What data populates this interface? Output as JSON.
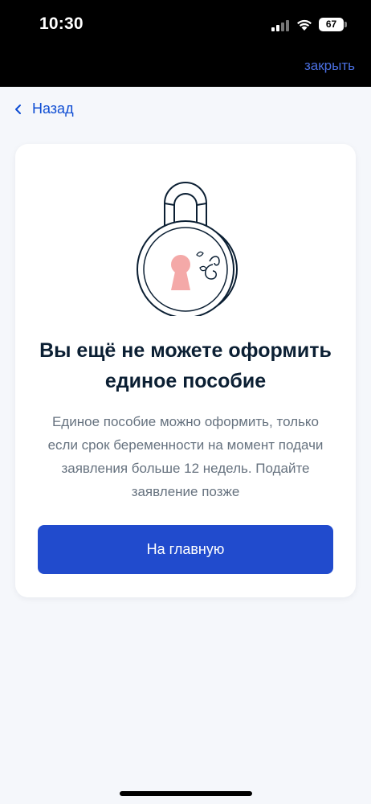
{
  "status_bar": {
    "time": "10:30",
    "battery": "67"
  },
  "header": {
    "close_label": "закрыть"
  },
  "nav": {
    "back_label": "Назад"
  },
  "card": {
    "title": "Вы ещё не можете оформить единое пособие",
    "description": "Единое пособие можно оформить, только если срок беременности на момент подачи заявления больше 12 недель. Подайте заявление позже",
    "button_label": "На главную"
  },
  "icons": [
    "signal-icon",
    "wifi-icon",
    "battery-icon",
    "chevron-left-icon",
    "padlock-icon"
  ],
  "colors": {
    "primary": "#214bcd",
    "link": "#0d4cd3",
    "background": "#f5f7fb",
    "keyhole": "#f4a9a8"
  }
}
